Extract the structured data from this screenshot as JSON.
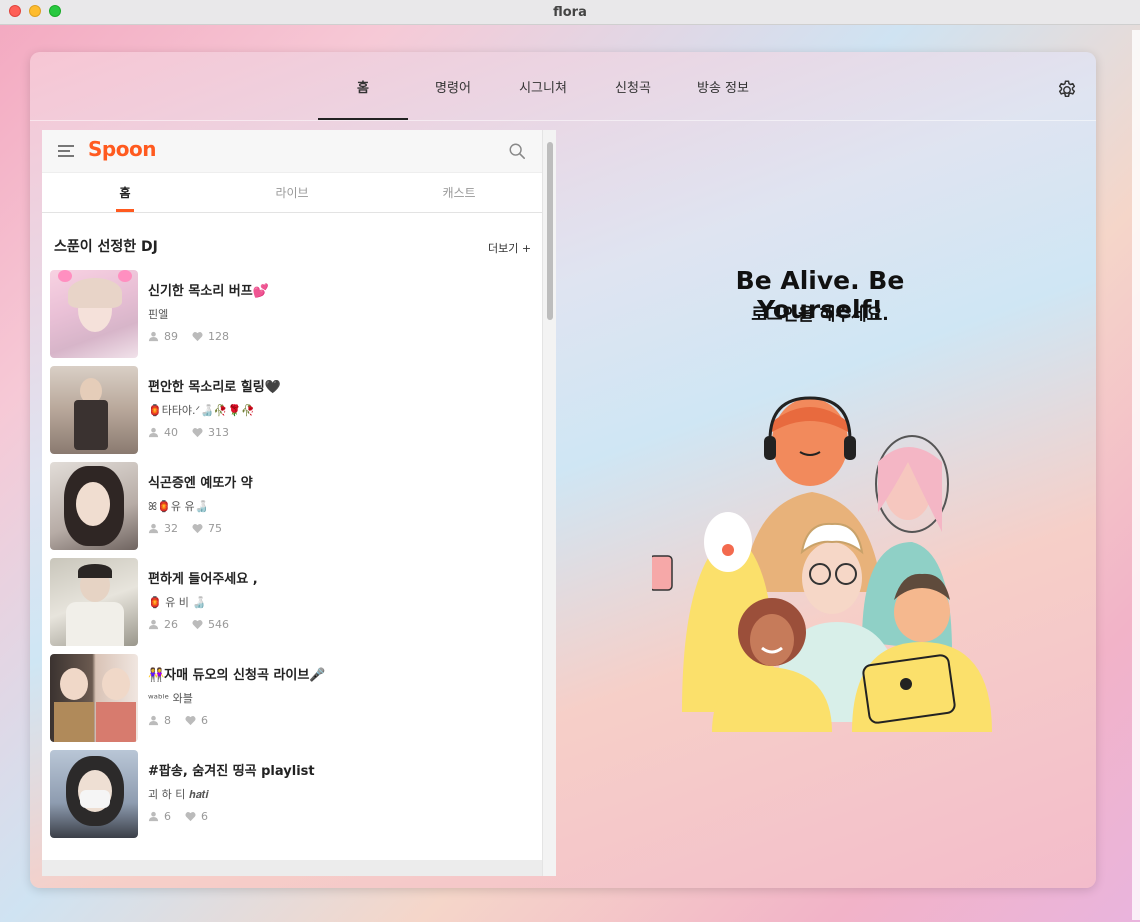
{
  "window": {
    "title": "flora"
  },
  "nav": {
    "tabs": [
      {
        "label": "홈"
      },
      {
        "label": "명령어"
      },
      {
        "label": "시그니쳐"
      },
      {
        "label": "신청곡"
      },
      {
        "label": "방송 정보"
      }
    ],
    "active_index": 0,
    "settings_icon": "gear-icon"
  },
  "spoon": {
    "logo": "Spoon",
    "tabs": [
      {
        "label": "홈"
      },
      {
        "label": "라이브"
      },
      {
        "label": "캐스트"
      }
    ],
    "section_title": "스푼이 선정한 DJ",
    "more_label": "더보기 +",
    "brand_color": "#ff5a1f",
    "djs": [
      {
        "title": "신기한 목소리 버프💕",
        "nickname": "핀엘",
        "listeners": "89",
        "likes": "128"
      },
      {
        "title": "편안한 목소리로 힐링🖤",
        "nickname": "🏮타타야.ᐟ🍶🥀🌹🥀",
        "listeners": "40",
        "likes": "313"
      },
      {
        "title": "식곤증엔 예또가 약",
        "nickname": "ꕤ🏮유 유🍶",
        "listeners": "32",
        "likes": "75"
      },
      {
        "title": "편하게 들어주세요 ,",
        "nickname": "🏮 유 비 🍶",
        "listeners": "26",
        "likes": "546"
      },
      {
        "title": "👭자매 듀오의 신청곡 라이브🎤",
        "nickname": "ʷᵃᵇˡᵉ 와블",
        "listeners": "8",
        "likes": "6"
      },
      {
        "title": "#팝송, 숨겨진 띵곡 playlist",
        "nickname": "괴 하 티 𝒉𝒂𝒕𝒊",
        "listeners": "6",
        "likes": "6"
      }
    ]
  },
  "hero": {
    "title": "Be Alive. Be Yourself!",
    "subtitle": "로그인을 해주세요."
  }
}
